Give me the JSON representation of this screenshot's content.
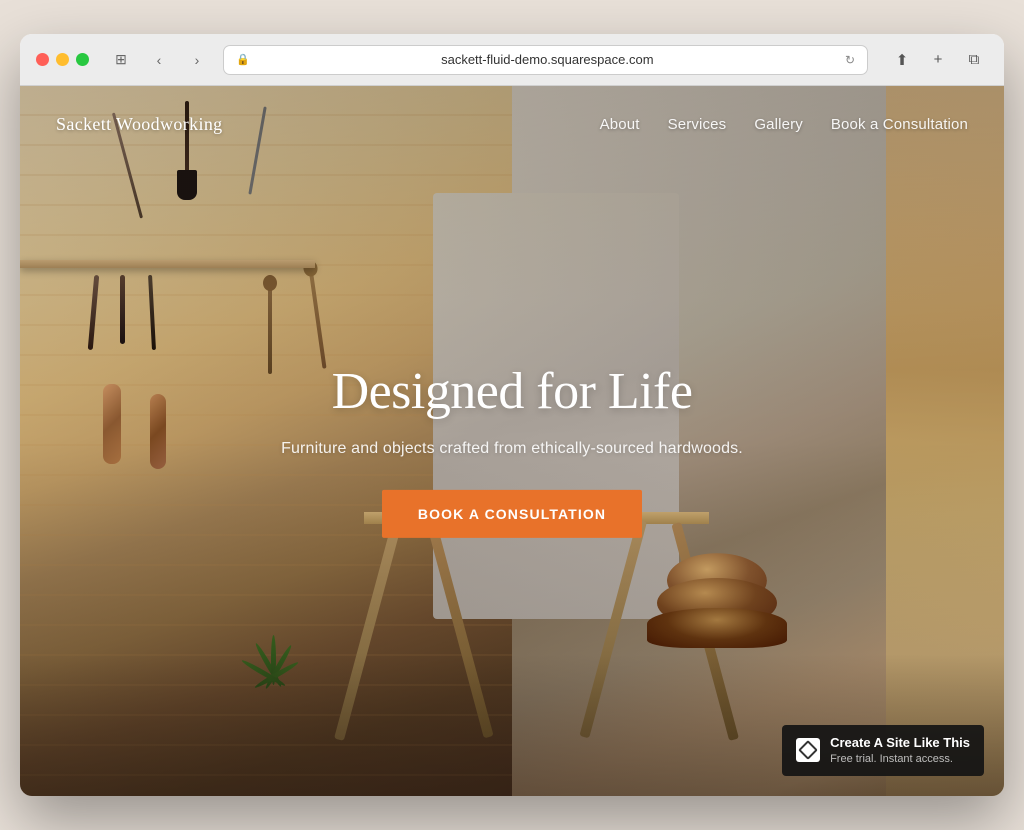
{
  "browser": {
    "url": "sackett-fluid-demo.squarespace.com",
    "tab_icon": "🔒"
  },
  "nav": {
    "logo": "Sackett Woodworking",
    "links": [
      {
        "label": "About",
        "id": "about"
      },
      {
        "label": "Services",
        "id": "services"
      },
      {
        "label": "Gallery",
        "id": "gallery"
      },
      {
        "label": "Book a Consultation",
        "id": "book-consultation-nav"
      }
    ]
  },
  "hero": {
    "title": "Designed for Life",
    "subtitle": "Furniture and objects crafted from ethically-sourced hardwoods.",
    "cta_label": "Book a Consultation"
  },
  "badge": {
    "main": "Create A Site Like This",
    "sub": "Free trial. Instant access."
  },
  "colors": {
    "cta_orange": "#e8722a",
    "nav_text": "rgba(255,255,255,0.92)",
    "badge_bg": "rgba(20,20,20,0.92)"
  }
}
